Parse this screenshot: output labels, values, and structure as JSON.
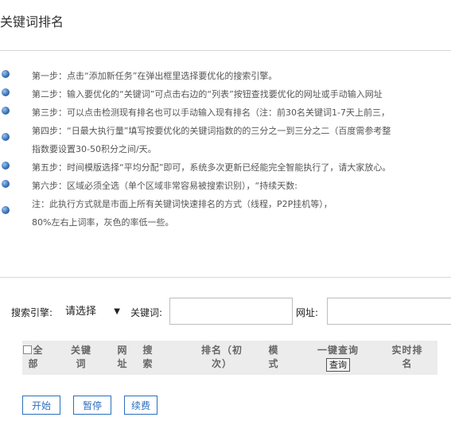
{
  "page": {
    "title": "关键词排名"
  },
  "steps": [
    {
      "lines": [
        "第一步：点击“添加新任务”在弹出框里选择要优化的搜索引擎。"
      ]
    },
    {
      "lines": [
        "第二步：输入要优化的“关键词”可点击右边的“列表”按钮查找要优化的网址或手动输入网址"
      ]
    },
    {
      "lines": [
        "第三步：可以点击检测现有排名也可以手动输入现有排名（注：前30名关键词1-7天上前三，"
      ]
    },
    {
      "lines": [
        "第四步：“日最大执行量”填写按要优化的关键词指数的的三分之一到三分之二（百度需参考整",
        "指数要设置30-50积分之间/天。"
      ]
    },
    {
      "lines": [
        "第五步：时间模版选择“平均分配”即可，系统多次更新已经能完全智能执行了，请大家放心。"
      ]
    },
    {
      "lines": [
        "第六步：区域必须全选（单个区域非常容易被搜索识别），“持续天数:"
      ]
    },
    {
      "lines": [
        "注：此执行方式就是市面上所有关键词快速排名的方式（线程，P2P挂机等），",
        "80%左右上词率，灰色的率低一些。"
      ]
    }
  ],
  "search": {
    "engine_label": "搜索引擎:",
    "engine_value": "请选择",
    "keyword_label": "关键词:",
    "keyword_value": "",
    "url_label": "网址:",
    "url_value": ""
  },
  "table": {
    "select_all": [
      "全",
      "部"
    ],
    "columns": [
      [
        "关键",
        "词"
      ],
      [
        "网",
        "址"
      ],
      [
        "搜",
        "索"
      ],
      [
        "排名（初",
        "次）"
      ],
      [
        "模",
        "式"
      ],
      [
        "一键查询"
      ],
      [
        "实时排",
        "名"
      ]
    ],
    "query_button": "查询"
  },
  "actions": {
    "start": "开始",
    "pause": "暂停",
    "renew": "续费"
  }
}
